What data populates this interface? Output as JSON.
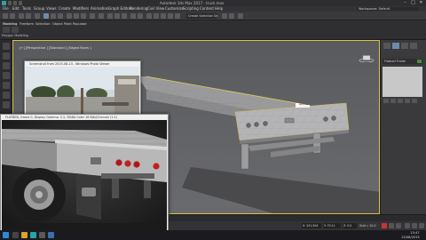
{
  "window": {
    "title": "Autodesk 3ds Max 2017 - truck.max",
    "minimize": "–",
    "maximize": "□",
    "close": "✕"
  },
  "menu": {
    "items": [
      "File",
      "Edit",
      "Tools",
      "Group",
      "Views",
      "Create",
      "Modifiers",
      "Animation",
      "Graph Editors",
      "Rendering",
      "Civil View",
      "Customize",
      "Scripting",
      "Content",
      "Help"
    ],
    "workspace": "Workspaces: Default"
  },
  "toolbar": {
    "selection_set": "Create Selection Se"
  },
  "ribbon": {
    "tabs": [
      "Modeling",
      "Freeform",
      "Selection",
      "Object Paint",
      "Populate"
    ],
    "active_tab": "Modeling",
    "panel_label": "Polygon Modeling"
  },
  "viewport": {
    "label": "[+] [Perspective ] [Standard ] [Edged Faces ]"
  },
  "ref_window": {
    "title": "Screenshot from 2015-08-13 - Windows Photo Viewer"
  },
  "render_window": {
    "title": "FLATBED, frame 0, Display Gamma: 2.2, RGBA Color 16 Bits/Channel (1:1)"
  },
  "command_panel": {
    "object_name": "Flatbed Trailer"
  },
  "status": {
    "x_value": "X: 241.504",
    "y_value": "Y: 70.11",
    "z_value": "Z: 0.0",
    "grid": "Grid = 10.0",
    "time": "15:47",
    "date": "13/08/2015"
  },
  "colors": {
    "viewport_bg": "#5b5b5e",
    "selection_border": "#d9c247",
    "ui_dark": "#262626"
  }
}
